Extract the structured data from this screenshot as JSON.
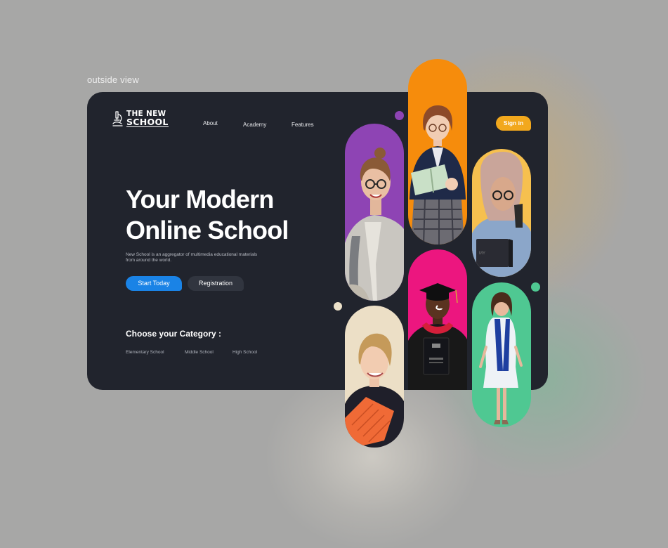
{
  "outside_label": "outside view",
  "logo": {
    "line1": "THE NEW",
    "line2": "SCHOOL",
    "icon": "microscope-icon"
  },
  "nav": {
    "about": "About",
    "academy": "Academy",
    "features": "Features"
  },
  "signin_label": "Sign in",
  "hero": {
    "title_line1": "Your Modern",
    "title_line2": "Online School",
    "description": "New School is an aggregator of multimedia educational materials from around the world."
  },
  "buttons": {
    "start": "Start Today",
    "registration": "Registration"
  },
  "category": {
    "heading": "Choose your Category :",
    "items": [
      "Elementary School",
      "Middle School",
      "High School"
    ]
  },
  "colors": {
    "background": "#a7a7a6",
    "card": "#21242d",
    "accent_blue": "#1a83e6",
    "signin_orange": "#f2a81d",
    "pill_purple": "#8e44b4",
    "pill_orange": "#f68c0c",
    "pill_yellow": "#f6c04f",
    "pill_magenta": "#ec167f",
    "pill_cream": "#ecdfc6",
    "pill_green": "#4fc892"
  }
}
